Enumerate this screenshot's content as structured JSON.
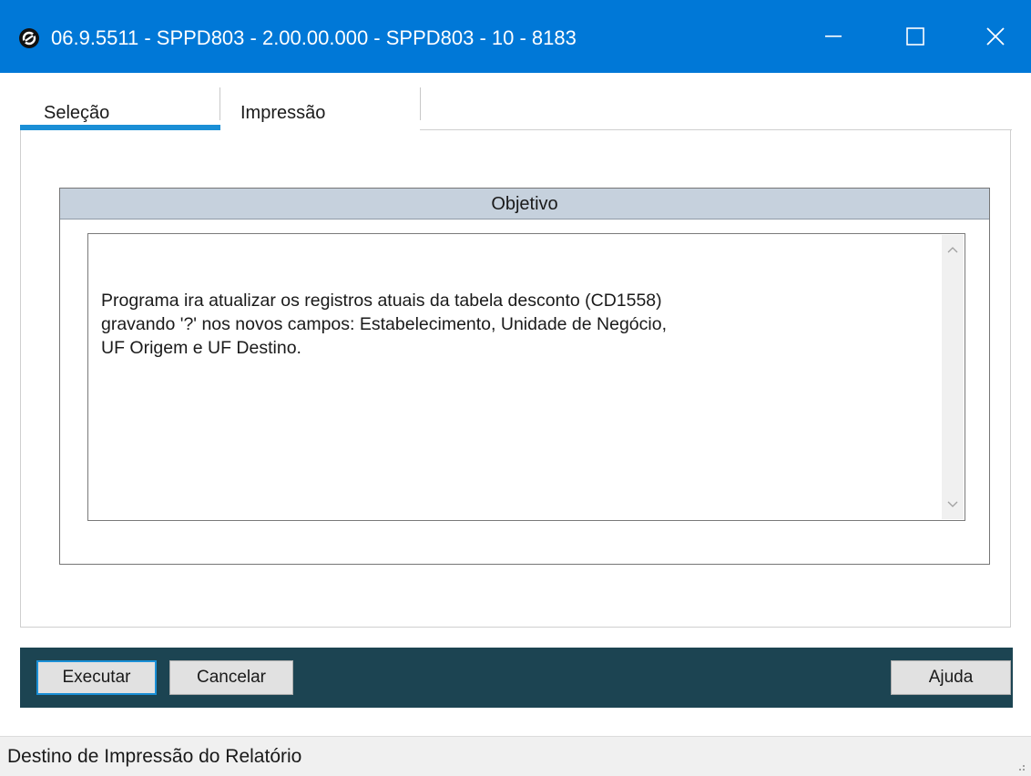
{
  "window": {
    "title": "06.9.5511 - SPPD803 - 2.00.00.000 - SPPD803 - 10 - 8183",
    "icon": "totvs-logo-icon",
    "controls": [
      "minimize-icon",
      "maximize-icon",
      "close-icon"
    ],
    "accent_color": "#0078d7"
  },
  "tabs": [
    {
      "label": "Seleção",
      "active": true
    },
    {
      "label": "Impressão",
      "active": false
    }
  ],
  "objective": {
    "header": "Objetivo",
    "lines": [
      "Programa ira atualizar os registros atuais da tabela desconto (CD1558)",
      "gravando '?' nos novos campos: Estabelecimento, Unidade de Negócio,",
      "UF Origem e UF Destino."
    ]
  },
  "actions": {
    "execute_label": "Executar",
    "cancel_label": "Cancelar",
    "help_label": "Ajuda",
    "bar_color": "#1c4452"
  },
  "status": {
    "text": "Destino de Impressão do Relatório"
  }
}
